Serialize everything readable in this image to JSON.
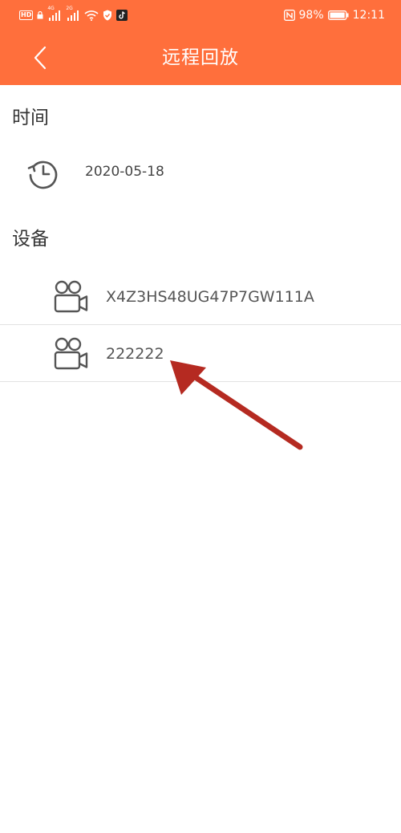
{
  "status_bar": {
    "hd_label": "HD",
    "sig1_label": "4G",
    "sig2_label": "2G",
    "battery_pct": "98%",
    "time": "12:11",
    "icons": [
      "hd-icon",
      "lock-icon",
      "signal-icon",
      "signal-icon",
      "wifi-icon",
      "shield-icon",
      "tiktok-icon",
      "nfc-icon",
      "battery-icon"
    ]
  },
  "header": {
    "title": "远程回放",
    "background": "#ff6f3c"
  },
  "time_section": {
    "heading": "时间",
    "date": "2020-05-18"
  },
  "device_section": {
    "heading": "设备",
    "devices": [
      {
        "label": "X4Z3HS48UG47P7GW111A",
        "icon": "video-camera-icon"
      },
      {
        "label": "222222",
        "icon": "video-camera-icon"
      }
    ]
  },
  "annotation": {
    "color": "#b52a21"
  }
}
